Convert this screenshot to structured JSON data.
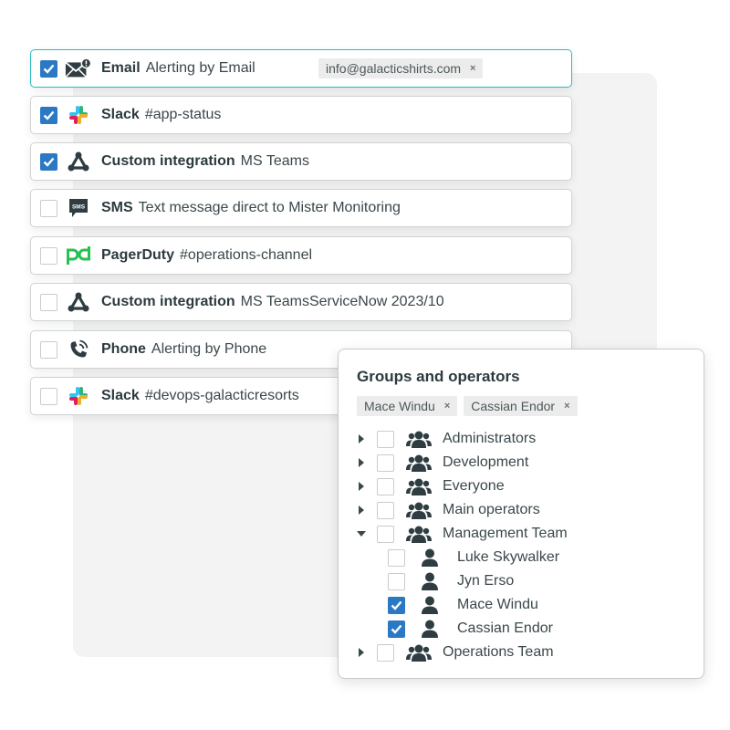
{
  "channels": [
    {
      "name": "Email",
      "desc": "Alerting by Email",
      "checked": true,
      "icon": "email-alert-icon",
      "tag": "info@galacticshirts.com",
      "active": true
    },
    {
      "name": "Slack",
      "desc": "#app-status",
      "checked": true,
      "icon": "slack-icon"
    },
    {
      "name": "Custom integration",
      "desc": "MS Teams",
      "checked": true,
      "icon": "custom-integration-icon"
    },
    {
      "name": "SMS",
      "desc": "Text message direct to Mister Monitoring",
      "checked": false,
      "icon": "sms-icon"
    },
    {
      "name": "PagerDuty",
      "desc": "#operations-channel",
      "checked": false,
      "icon": "pagerduty-icon"
    },
    {
      "name": "Custom integration",
      "desc": "MS TeamsServiceNow 2023/10",
      "checked": false,
      "icon": "custom-integration-icon"
    },
    {
      "name": "Phone",
      "desc": "Alerting by Phone",
      "checked": false,
      "icon": "phone-icon"
    },
    {
      "name": "Slack",
      "desc": "#devops-galacticresorts",
      "checked": false,
      "icon": "slack-icon"
    }
  ],
  "popup": {
    "title": "Groups and operators",
    "selected_tags": [
      "Mace Windu",
      "Cassian Endor"
    ],
    "tag_remove_glyph": "×",
    "tree": [
      {
        "label": "Administrators",
        "type": "group",
        "expanded": false,
        "checked": false
      },
      {
        "label": "Development",
        "type": "group",
        "expanded": false,
        "checked": false
      },
      {
        "label": "Everyone",
        "type": "group",
        "expanded": false,
        "checked": false
      },
      {
        "label": "Main operators",
        "type": "group",
        "expanded": false,
        "checked": false
      },
      {
        "label": "Management Team",
        "type": "group",
        "expanded": true,
        "checked": false
      },
      {
        "label": "Luke Skywalker",
        "type": "user",
        "checked": false
      },
      {
        "label": "Jyn Erso",
        "type": "user",
        "checked": false
      },
      {
        "label": "Mace Windu",
        "type": "user",
        "checked": true
      },
      {
        "label": "Cassian Endor",
        "type": "user",
        "checked": true
      },
      {
        "label": "Operations Team",
        "type": "group",
        "expanded": false,
        "checked": false
      }
    ]
  },
  "colors": {
    "accent": "#2b78c5",
    "active_border": "#29bcc4",
    "pagerduty": "#25c151",
    "icon_dark": "#2f3d42"
  }
}
